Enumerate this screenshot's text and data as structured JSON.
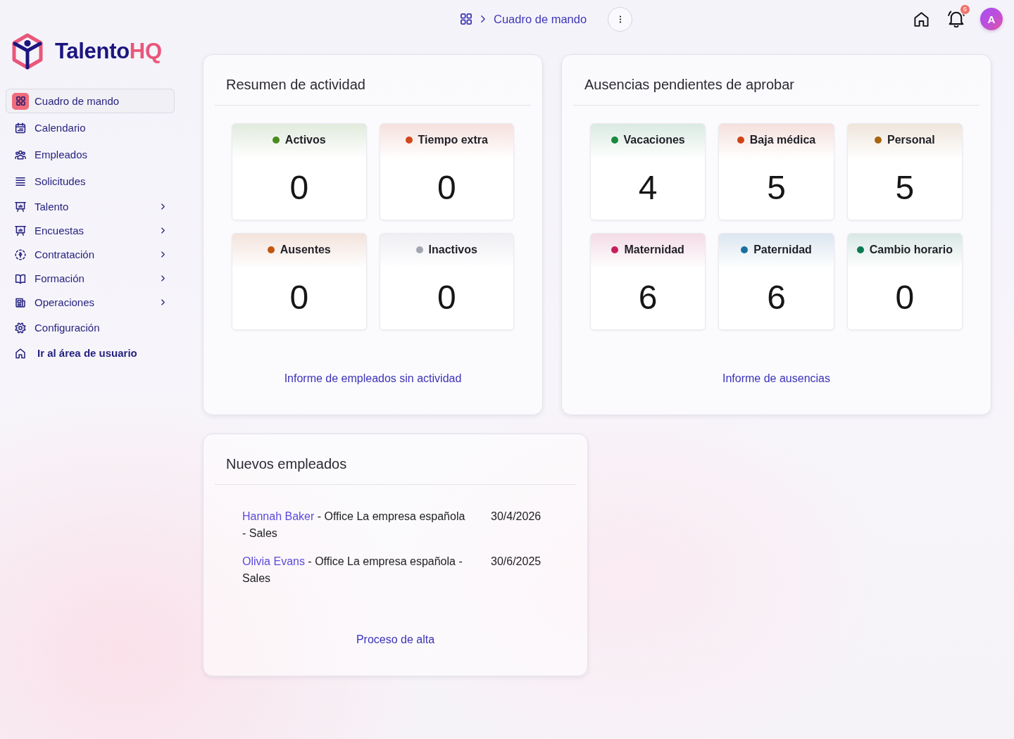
{
  "logo": {
    "text": "Talento",
    "accent": "HQ"
  },
  "sidebar": {
    "items": [
      {
        "label": "Cuadro de mando",
        "selected": true,
        "has_submenu": false
      },
      {
        "label": "Calendario",
        "selected": false,
        "has_submenu": false
      },
      {
        "label": "Empleados",
        "selected": false,
        "has_submenu": false
      },
      {
        "label": "Solicitudes",
        "selected": false,
        "has_submenu": false
      },
      {
        "label": "Talento",
        "selected": false,
        "has_submenu": true
      },
      {
        "label": "Encuestas",
        "selected": false,
        "has_submenu": true
      },
      {
        "label": "Contratación",
        "selected": false,
        "has_submenu": true
      },
      {
        "label": "Formación",
        "selected": false,
        "has_submenu": true
      },
      {
        "label": "Operaciones",
        "selected": false,
        "has_submenu": true
      },
      {
        "label": "Configuración",
        "selected": false,
        "has_submenu": false
      }
    ],
    "user_area_link": {
      "label": "Ir al área de usuario"
    }
  },
  "topbar": {
    "breadcrumb": "Cuadro de mando",
    "notifications": {
      "count": "6"
    },
    "avatar": {
      "initial": "A"
    }
  },
  "activity": {
    "title": "Resumen de actividad",
    "stats": [
      {
        "label": "Activos",
        "value": "0",
        "color": "#4a8c1c"
      },
      {
        "label": "Tiempo extra",
        "value": "0",
        "color": "#d2461a"
      },
      {
        "label": "Ausentes",
        "value": "0",
        "color": "#c2560f"
      },
      {
        "label": "Inactivos",
        "value": "0",
        "color": "#a3a6b0"
      }
    ],
    "link": "Informe de empleados sin actividad"
  },
  "absences": {
    "title": "Ausencias pendientes de aprobar",
    "stats": [
      {
        "label": "Vacaciones",
        "value": "4",
        "color": "#178a3e"
      },
      {
        "label": "Baja médica",
        "value": "5",
        "color": "#cc4514"
      },
      {
        "label": "Personal",
        "value": "5",
        "color": "#a8650e"
      },
      {
        "label": "Maternidad",
        "value": "6",
        "color": "#c51f5d"
      },
      {
        "label": "Paternidad",
        "value": "6",
        "color": "#1b6fa0"
      },
      {
        "label": "Cambio horario",
        "value": "0",
        "color": "#0c7a50"
      }
    ],
    "link": "Informe de ausencias"
  },
  "new_employees": {
    "title": "Nuevos empleados",
    "rows": [
      {
        "name": "Hannah Baker",
        "detail": "- Office La empresa española - Sales",
        "date": "30/4/2026"
      },
      {
        "name": "Olivia Evans",
        "detail": "- Office La empresa española - Sales",
        "date": "30/6/2025"
      }
    ],
    "link": "Proceso de alta"
  }
}
